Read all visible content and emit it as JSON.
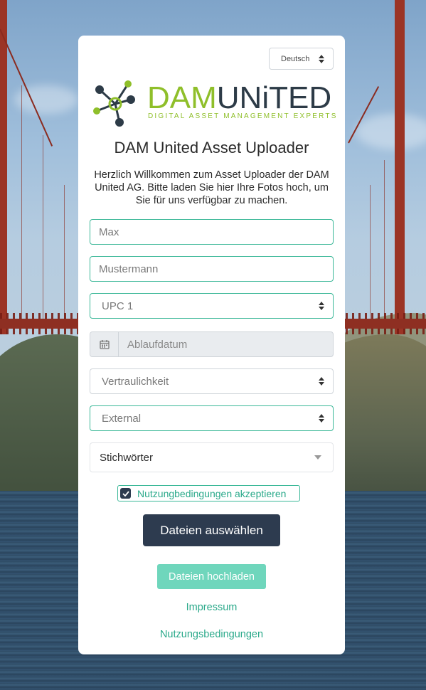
{
  "language": {
    "selected": "Deutsch"
  },
  "logo": {
    "brand_dam": "DAM",
    "brand_united": "UNiTED",
    "tagline": "DIGITAL ASSET MANAGEMENT EXPERTS",
    "colors": {
      "green": "#8fbf2a",
      "dark": "#2d3b47"
    }
  },
  "title": "DAM United Asset Uploader",
  "intro": "Herzlich Willkommen zum Asset Uploader der DAM United AG. Bitte laden Sie hier Ihre Fotos hoch, um Sie für uns verfügbar zu machen.",
  "form": {
    "first_name": {
      "value": "Max"
    },
    "last_name": {
      "value": "Mustermann"
    },
    "upc": {
      "selected": "UPC 1"
    },
    "expiry": {
      "placeholder": "Ablaufdatum",
      "icon": "calendar-icon"
    },
    "confidentiality": {
      "selected": "Vertraulichkeit"
    },
    "audience": {
      "selected": "External"
    },
    "keywords": {
      "placeholder": "Stichwörter"
    },
    "terms": {
      "label": "Nutzungbedingungen akzeptieren",
      "checked": true
    }
  },
  "buttons": {
    "choose_files": "Dateien auswählen",
    "upload_files": "Dateien hochladen"
  },
  "links": {
    "imprint": "Impressum",
    "terms_of_use": "Nutzungsbedingungen"
  },
  "colors": {
    "accent": "#3bb898",
    "dark_button": "#2d3b4f",
    "upload_button": "#6fd6bc"
  }
}
